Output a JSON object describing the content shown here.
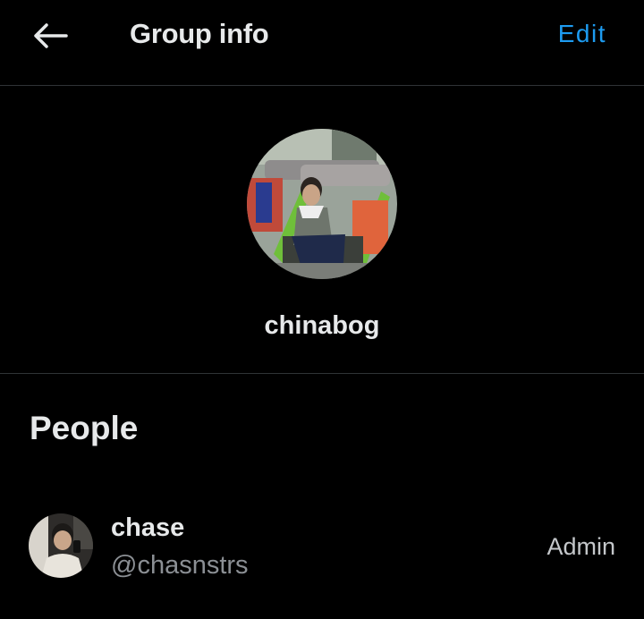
{
  "header": {
    "back_icon": "arrow-left-icon",
    "title": "Group info",
    "edit_label": "Edit"
  },
  "group": {
    "name": "chinabog",
    "avatar": "group-photo"
  },
  "people": {
    "heading": "People",
    "members": [
      {
        "name": "chase",
        "handle": "@chasnstrs",
        "role": "Admin"
      }
    ]
  },
  "colors": {
    "background": "#000000",
    "accent": "#1d9bf0",
    "divider": "#2f3336",
    "text_primary": "#e7e9ea",
    "text_secondary": "#8b8f94"
  }
}
